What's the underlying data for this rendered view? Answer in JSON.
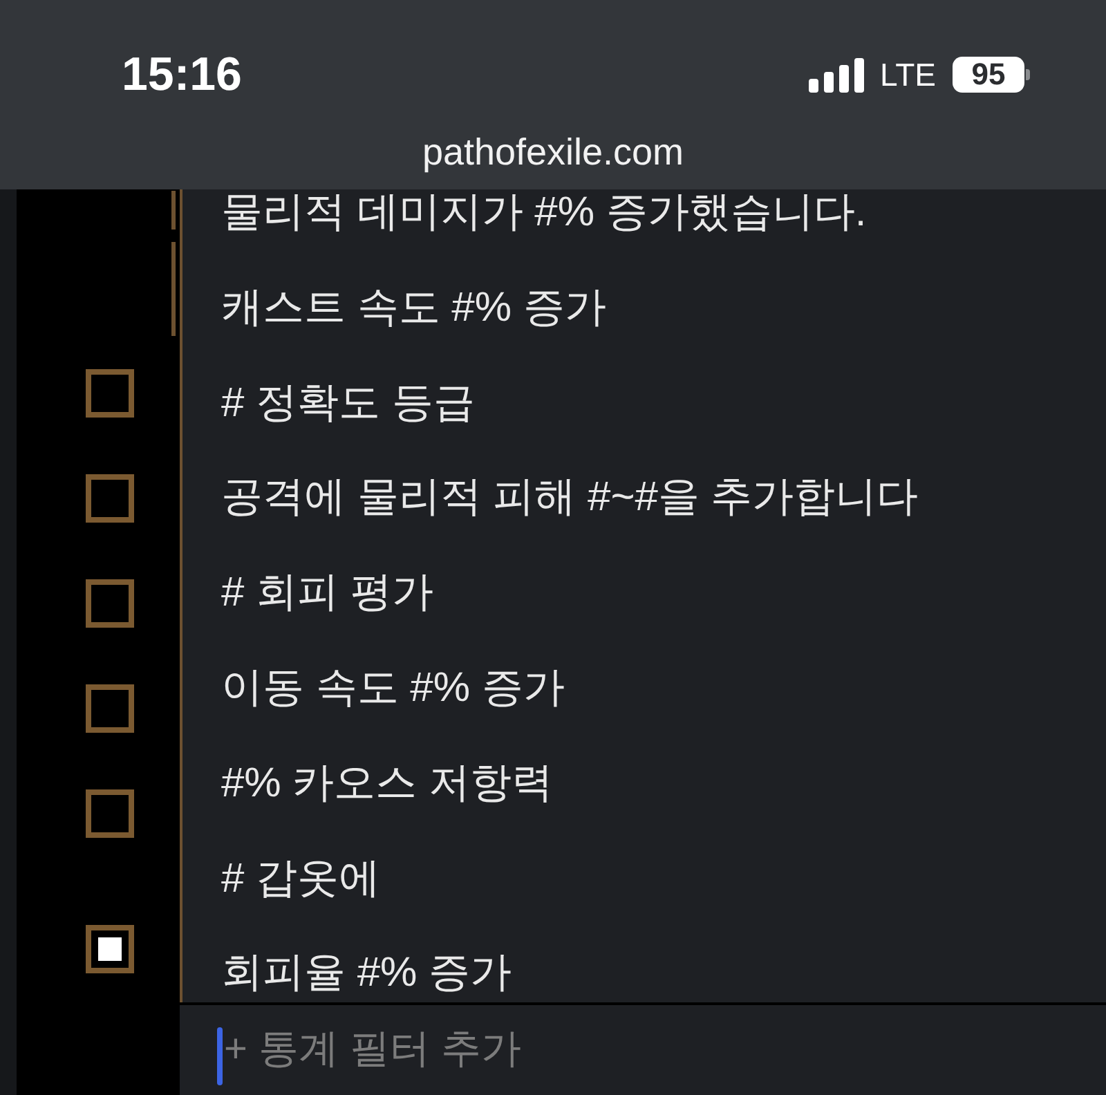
{
  "status_bar": {
    "time": "15:16",
    "network": "LTE",
    "battery": "95"
  },
  "address_bar": {
    "url": "pathofexile.com"
  },
  "filter_checkboxes": [
    {
      "checked": false
    },
    {
      "checked": false
    },
    {
      "checked": false
    },
    {
      "checked": false
    },
    {
      "checked": false
    },
    {
      "checked": true
    }
  ],
  "stat_options": [
    {
      "label": "물리적 데미지가 #% 증가했습니다."
    },
    {
      "label": "캐스트 속도 #% 증가"
    },
    {
      "label": "# 정확도 등급"
    },
    {
      "label": "공격에 물리적 피해 #~#을 추가합니다"
    },
    {
      "label": "# 회피 평가"
    },
    {
      "label": "이동 속도 #% 증가"
    },
    {
      "label": "#% 카오스 저항력"
    },
    {
      "label": "# 갑옷에"
    },
    {
      "label": "회피율 #% 증가"
    }
  ],
  "stat_filter_input": {
    "placeholder": "+ 통계 필터 추가"
  }
}
